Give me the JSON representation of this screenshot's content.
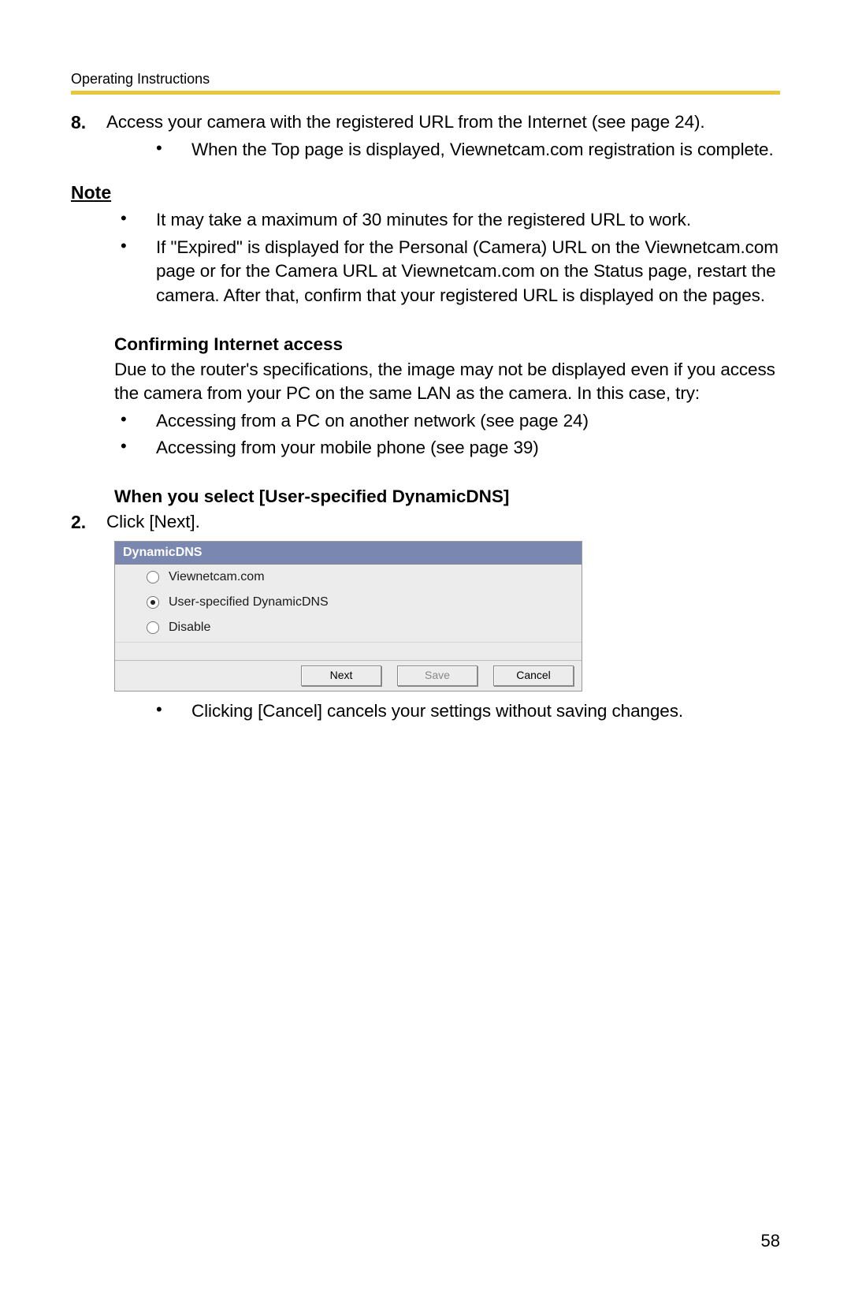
{
  "header": "Operating Instructions",
  "step8": {
    "num": "8.",
    "text": "Access your camera with the registered URL from the Internet (see page 24).",
    "sub1": "When the Top page is displayed, Viewnetcam.com registration is complete."
  },
  "note": {
    "heading": "Note",
    "b1": "It may take a maximum of 30 minutes for the registered URL to work.",
    "b2": "If \"Expired\" is displayed for the Personal (Camera) URL on the Viewnetcam.com page or for the Camera URL at Viewnetcam.com on the Status page, restart the camera. After that, confirm that your registered URL is displayed on the pages."
  },
  "confirm": {
    "heading": "Confirming Internet access",
    "text": "Due to the router's specifications, the image may not be displayed even if you access the camera from your PC on the same LAN as the camera. In this case, try:",
    "b1": "Accessing from a PC on another network (see page 24)",
    "b2": "Accessing from your mobile phone (see page 39)"
  },
  "dyn": {
    "heading": "When you select [User-specified DynamicDNS]",
    "step_num": "2.",
    "step_text": "Click [Next].",
    "after": "Clicking [Cancel] cancels your settings without saving changes."
  },
  "screenshot": {
    "title": "DynamicDNS",
    "opt1": "Viewnetcam.com",
    "opt2": "User-specified DynamicDNS",
    "opt3": "Disable",
    "btn_next": "Next",
    "btn_save": "Save",
    "btn_cancel": "Cancel"
  },
  "page_number": "58"
}
